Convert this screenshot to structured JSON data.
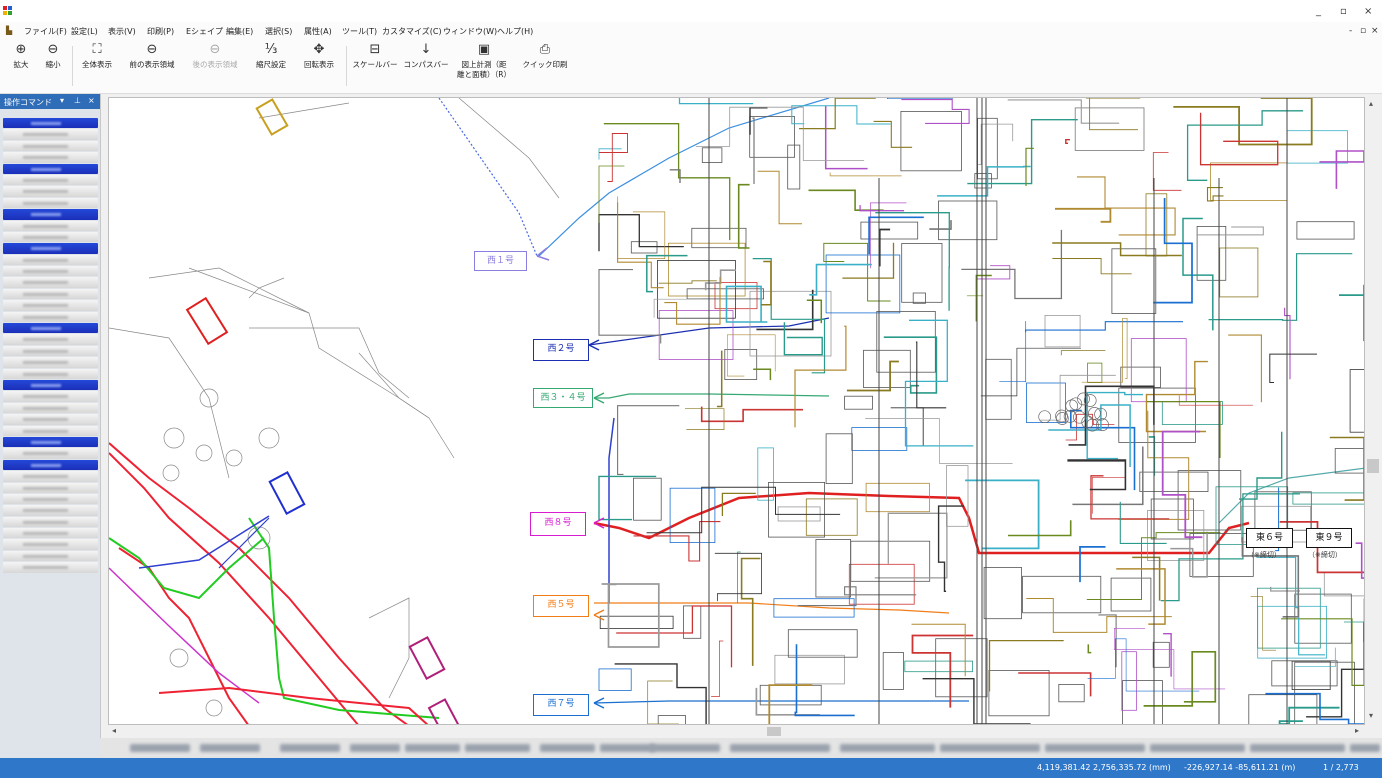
{
  "window": {
    "minimize_glyph": "_",
    "restore_glyph": "▫",
    "close_glyph": "×",
    "brand_colors": [
      "#e02020",
      "#2060d0",
      "#f0b000",
      "#30a030"
    ]
  },
  "menu": {
    "items": [
      "ファイル(F)",
      "設定(L)",
      "表示(V)",
      "印刷(P)",
      "Eシェイプ",
      "編集(E)",
      "選択(S)",
      "属性(A)",
      "ツール(T)",
      "カスタマイズ(C)",
      "ウィンドウ(W)",
      "ヘルプ(H)"
    ],
    "right_controls": [
      "-",
      "▫",
      "×"
    ]
  },
  "ribbon": {
    "buttons": [
      {
        "label": "拡大",
        "icon": "zoom-in-icon",
        "glyph": "⊕",
        "enabled": true
      },
      {
        "label": "縮小",
        "icon": "zoom-out-icon",
        "glyph": "⊖",
        "enabled": true
      },
      {
        "label": "全体表示",
        "icon": "fit-all-icon",
        "glyph": "⛶",
        "enabled": true
      },
      {
        "label": "前の表示領域",
        "icon": "previous-view-icon",
        "glyph": "⊖",
        "enabled": true
      },
      {
        "label": "後の表示領域",
        "icon": "next-view-icon",
        "glyph": "⊖",
        "enabled": false
      },
      {
        "label": "縮尺設定",
        "icon": "scale-setting-icon",
        "glyph": "⅓",
        "enabled": true
      },
      {
        "label": "回転表示",
        "icon": "rotate-view-icon",
        "glyph": "✥",
        "enabled": true
      },
      {
        "label": "スケールバー",
        "icon": "scale-bar-icon",
        "glyph": "⊟",
        "enabled": true
      },
      {
        "label": "コンパスバー",
        "icon": "compass-bar-icon",
        "glyph": "↓",
        "enabled": true
      },
      {
        "label": "図上計測（距\n離と面積）（R）",
        "icon": "measure-icon",
        "glyph": "▣",
        "enabled": true
      },
      {
        "label": "クイック印刷",
        "icon": "quick-print-icon",
        "glyph": "⎙",
        "enabled": true
      }
    ]
  },
  "panel": {
    "title": "操作コマンド",
    "controls": [
      "▾",
      "⊥",
      "×"
    ]
  },
  "map": {
    "callouts": [
      {
        "label": "西１号",
        "color": "#8a7ee0"
      },
      {
        "label": "西２号",
        "color": "#1c2fb0"
      },
      {
        "label": "西３・４号",
        "color": "#36a872"
      },
      {
        "label": "西８号",
        "color": "#d81cd0"
      },
      {
        "label": "西５号",
        "color": "#f07d18"
      },
      {
        "label": "西７号",
        "color": "#1a6fd0"
      },
      {
        "label": "東６号",
        "color": "#111111"
      },
      {
        "label": "東９号",
        "color": "#111111"
      }
    ],
    "notes": [
      "（※締切）",
      "（※締切）"
    ]
  },
  "status": {
    "coords_mm": "4,119,381.42 2,756,335.72 (mm)",
    "coords_m": "-226,927.14 -85,611.21 (m)",
    "page": "1 / 2,773"
  }
}
